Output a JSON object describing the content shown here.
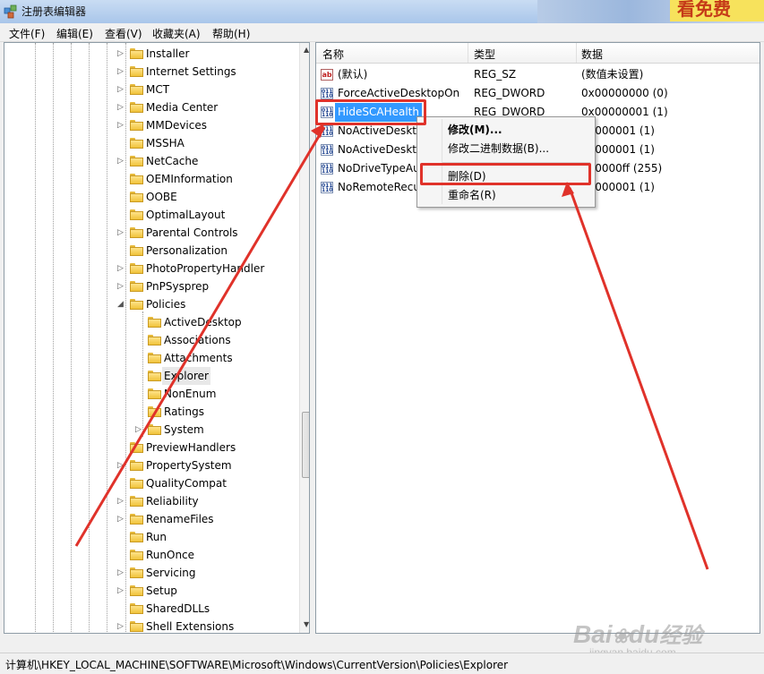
{
  "window": {
    "title": "注册表编辑器",
    "corner_watermark": "看免费"
  },
  "menu": [
    "文件(F)",
    "编辑(E)",
    "查看(V)",
    "收藏夹(A)",
    "帮助(H)"
  ],
  "tree": [
    {
      "label": "Installer",
      "level": 0,
      "expander": "collapsed"
    },
    {
      "label": "Internet Settings",
      "level": 0,
      "expander": "collapsed"
    },
    {
      "label": "MCT",
      "level": 0,
      "expander": "collapsed"
    },
    {
      "label": "Media Center",
      "level": 0,
      "expander": "collapsed"
    },
    {
      "label": "MMDevices",
      "level": 0,
      "expander": "collapsed"
    },
    {
      "label": "MSSHA",
      "level": 0,
      "expander": "none"
    },
    {
      "label": "NetCache",
      "level": 0,
      "expander": "collapsed"
    },
    {
      "label": "OEMInformation",
      "level": 0,
      "expander": "none"
    },
    {
      "label": "OOBE",
      "level": 0,
      "expander": "none"
    },
    {
      "label": "OptimalLayout",
      "level": 0,
      "expander": "none"
    },
    {
      "label": "Parental Controls",
      "level": 0,
      "expander": "collapsed"
    },
    {
      "label": "Personalization",
      "level": 0,
      "expander": "none"
    },
    {
      "label": "PhotoPropertyHandler",
      "level": 0,
      "expander": "collapsed"
    },
    {
      "label": "PnPSysprep",
      "level": 0,
      "expander": "collapsed"
    },
    {
      "label": "Policies",
      "level": 0,
      "expander": "expanded"
    },
    {
      "label": "ActiveDesktop",
      "level": 1,
      "expander": "none"
    },
    {
      "label": "Associations",
      "level": 1,
      "expander": "none"
    },
    {
      "label": "Attachments",
      "level": 1,
      "expander": "none"
    },
    {
      "label": "Explorer",
      "level": 1,
      "expander": "none",
      "selected": true
    },
    {
      "label": "NonEnum",
      "level": 1,
      "expander": "none"
    },
    {
      "label": "Ratings",
      "level": 1,
      "expander": "none"
    },
    {
      "label": "System",
      "level": 1,
      "expander": "collapsed"
    },
    {
      "label": "PreviewHandlers",
      "level": 0,
      "expander": "none"
    },
    {
      "label": "PropertySystem",
      "level": 0,
      "expander": "collapsed"
    },
    {
      "label": "QualityCompat",
      "level": 0,
      "expander": "none"
    },
    {
      "label": "Reliability",
      "level": 0,
      "expander": "collapsed"
    },
    {
      "label": "RenameFiles",
      "level": 0,
      "expander": "collapsed"
    },
    {
      "label": "Run",
      "level": 0,
      "expander": "none"
    },
    {
      "label": "RunOnce",
      "level": 0,
      "expander": "none"
    },
    {
      "label": "Servicing",
      "level": 0,
      "expander": "collapsed"
    },
    {
      "label": "Setup",
      "level": 0,
      "expander": "collapsed"
    },
    {
      "label": "SharedDLLs",
      "level": 0,
      "expander": "none"
    },
    {
      "label": "Shell Extensions",
      "level": 0,
      "expander": "collapsed"
    }
  ],
  "list": {
    "headers": {
      "name": "名称",
      "type": "类型",
      "data": "数据"
    },
    "rows": [
      {
        "icon": "string-value-icon",
        "name": "(默认)",
        "type": "REG_SZ",
        "data": "(数值未设置)"
      },
      {
        "icon": "binary-value-icon",
        "name": "ForceActiveDesktopOn",
        "type": "REG_DWORD",
        "data": "0x00000000 (0)"
      },
      {
        "icon": "binary-value-icon",
        "name": "HideSCAHealth",
        "type": "REG_DWORD",
        "data": "0x00000001 (1)",
        "selected": true
      },
      {
        "icon": "binary-value-icon",
        "name": "NoActiveDeskto",
        "type": "",
        "data": "00000001 (1)"
      },
      {
        "icon": "binary-value-icon",
        "name": "NoActiveDeskto",
        "type": "",
        "data": "00000001 (1)"
      },
      {
        "icon": "binary-value-icon",
        "name": "NoDriveTypeAu",
        "type": "",
        "data": "000000ff (255)"
      },
      {
        "icon": "binary-value-icon",
        "name": "NoRemoteRecu",
        "type": "",
        "data": "00000001 (1)"
      }
    ]
  },
  "context_menu": {
    "items": [
      {
        "label": "修改(M)...",
        "bold": true
      },
      {
        "label": "修改二进制数据(B)..."
      },
      {
        "label": "删除(D)"
      },
      {
        "label": "重命名(R)"
      }
    ]
  },
  "status": {
    "path": "计算机\\HKEY_LOCAL_MACHINE\\SOFTWARE\\Microsoft\\Windows\\CurrentVersion\\Policies\\Explorer"
  },
  "watermark": {
    "brand": "Bai",
    "brand2": "du",
    "cn": "经验",
    "url": "jingyan.baidu.com"
  },
  "colors": {
    "selection": "#3399ff",
    "highlight_box": "#e0322a",
    "annotation_arrow": "#e0322a"
  }
}
